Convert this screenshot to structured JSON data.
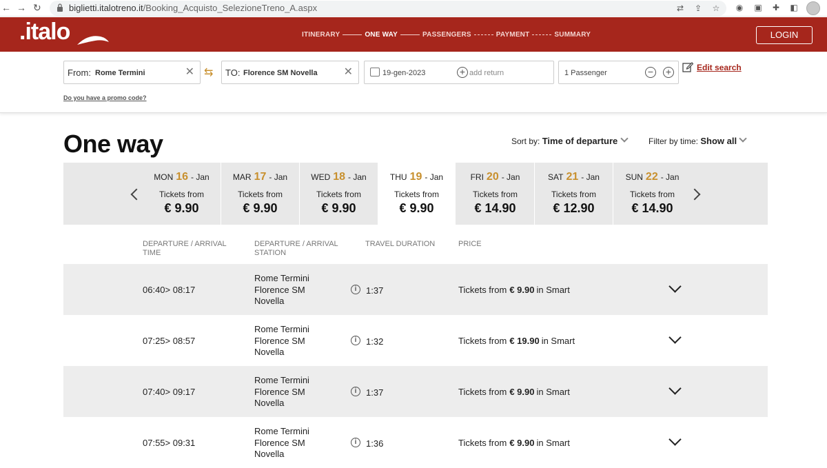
{
  "browser": {
    "url_host": "biglietti.italotreno.it",
    "url_path": "/Booking_Acquisto_SelezioneTreno_A.aspx"
  },
  "header": {
    "logo": ".italo",
    "steps": [
      {
        "label": "ITINERARY",
        "active": false
      },
      {
        "label": "ONE WAY",
        "active": true
      },
      {
        "label": "PASSENGERS",
        "active": false
      },
      {
        "label": "PAYMENT",
        "active": false
      },
      {
        "label": "SUMMARY",
        "active": false
      }
    ],
    "login_label": "LOGIN"
  },
  "search": {
    "from_label": "From:",
    "from_value": "Rome Termini",
    "to_label": "TO:",
    "to_value": "Florence SM Novella",
    "date_value": "19-gen-2023",
    "add_return_label": "add return",
    "passengers_value": "1 Passenger",
    "edit_search_label": "Edit search",
    "promo_label": "Do you have a promo code?"
  },
  "results": {
    "title": "One way",
    "sort_label": "Sort by:",
    "sort_value": "Time of departure",
    "filter_label": "Filter by time:",
    "filter_value": "Show all"
  },
  "dates": [
    {
      "dow": "MON",
      "num": "16",
      "month": "- Jan",
      "from": "Tickets from",
      "price": "€ 9.90",
      "selected": false
    },
    {
      "dow": "MAR",
      "num": "17",
      "month": "- Jan",
      "from": "Tickets from",
      "price": "€ 9.90",
      "selected": false
    },
    {
      "dow": "WED",
      "num": "18",
      "month": "- Jan",
      "from": "Tickets from",
      "price": "€ 9.90",
      "selected": false
    },
    {
      "dow": "THU",
      "num": "19",
      "month": "- Jan",
      "from": "Tickets from",
      "price": "€ 9.90",
      "selected": true
    },
    {
      "dow": "FRI",
      "num": "20",
      "month": "- Jan",
      "from": "Tickets from",
      "price": "€ 14.90",
      "selected": false
    },
    {
      "dow": "SAT",
      "num": "21",
      "month": "- Jan",
      "from": "Tickets from",
      "price": "€ 12.90",
      "selected": false
    },
    {
      "dow": "SUN",
      "num": "22",
      "month": "- Jan",
      "from": "Tickets from",
      "price": "€ 14.90",
      "selected": false
    }
  ],
  "table": {
    "headers": {
      "time_l1": "DEPARTURE / ARRIVAL",
      "time_l2": "TIME",
      "station_l1": "DEPARTURE / ARRIVAL",
      "station_l2": "STATION",
      "duration": "TRAVEL DURATION",
      "price": "PRICE"
    },
    "rows": [
      {
        "time": "06:40> 08:17",
        "dep": "Rome Termini",
        "arr1": "Florence SM",
        "arr2": "Novella",
        "duration": "1:37",
        "price_prefix": "Tickets from",
        "price": "€ 9.90",
        "price_suffix": "in Smart"
      },
      {
        "time": "07:25> 08:57",
        "dep": "Rome Termini",
        "arr1": "Florence SM",
        "arr2": "Novella",
        "duration": "1:32",
        "price_prefix": "Tickets from",
        "price": "€ 19.90",
        "price_suffix": "in Smart"
      },
      {
        "time": "07:40> 09:17",
        "dep": "Rome Termini",
        "arr1": "Florence SM",
        "arr2": "Novella",
        "duration": "1:37",
        "price_prefix": "Tickets from",
        "price": "€ 9.90",
        "price_suffix": "in Smart"
      },
      {
        "time": "07:55> 09:31",
        "dep": "Rome Termini",
        "arr1": "Florence SM",
        "arr2": "Novella",
        "duration": "1:36",
        "price_prefix": "Tickets from",
        "price": "€ 9.90",
        "price_suffix": "in Smart"
      }
    ]
  },
  "colors": {
    "brand": "#a6261c",
    "accent": "#c8902e",
    "row_shade": "#ededed",
    "strip": "#e8e8e8"
  }
}
